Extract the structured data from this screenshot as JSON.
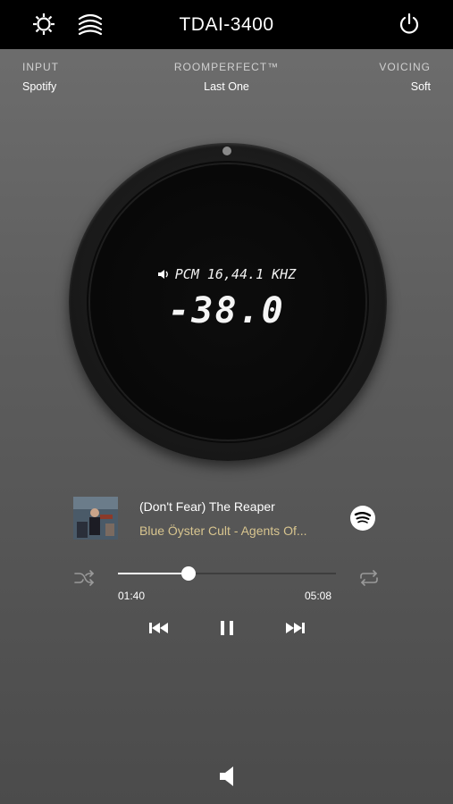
{
  "header": {
    "title": "TDAI-3400",
    "icons": [
      "gear-icon",
      "roomperfect-waves-icon",
      "power-icon"
    ]
  },
  "status": {
    "input_label": "INPUT",
    "input_value": "Spotify",
    "roomperfect_label": "ROOMPERFECT™",
    "roomperfect_value": "Last One",
    "voicing_label": "VOICING",
    "voicing_value": "Soft"
  },
  "knob": {
    "format": "PCM 16,44.1 KHZ",
    "volume": "-38.0"
  },
  "now_playing": {
    "title": "(Don't Fear) The Reaper",
    "artist": "Blue Öyster Cult - Agents Of...",
    "source_icon": "spotify-icon",
    "elapsed": "01:40",
    "duration": "05:08",
    "progress": 0.325
  },
  "colors": {
    "artist_text": "#d8c58f",
    "header_bg": "#000000"
  }
}
